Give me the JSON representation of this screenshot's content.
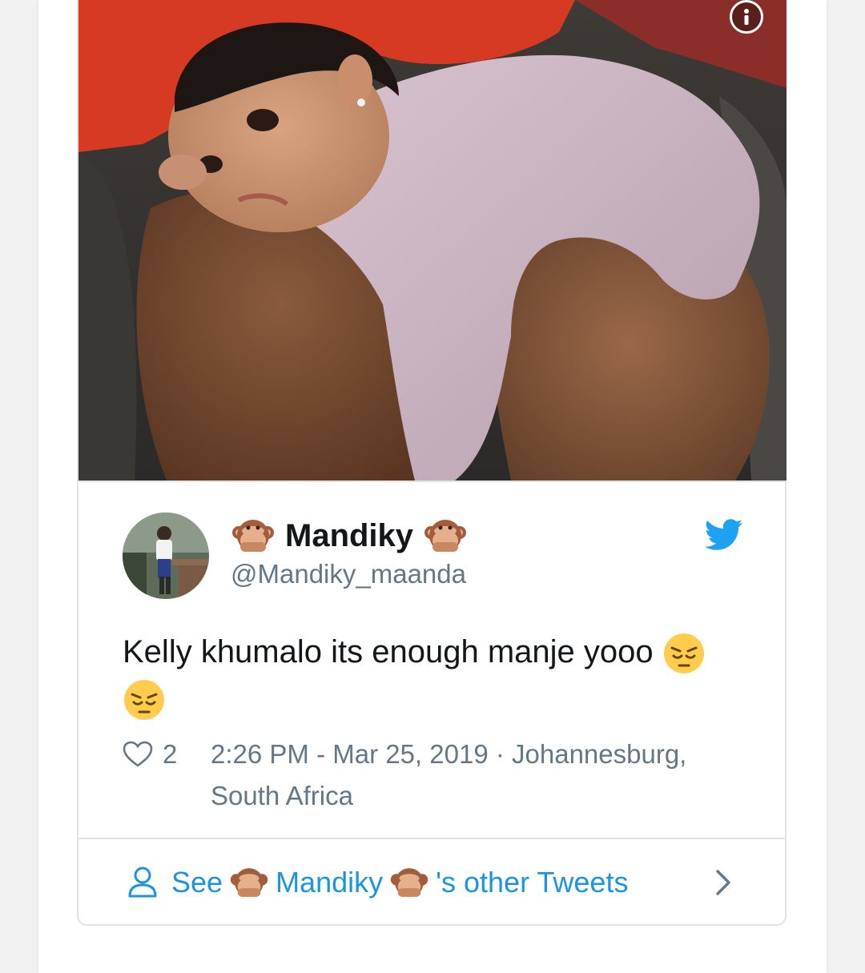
{
  "tweet": {
    "display_name": "Mandiky",
    "handle": "@Mandiky_maanda",
    "text": "Kelly khumalo its enough manje yooo",
    "likes": "2",
    "timestamp": "2:26 PM - Mar 25, 2019 · Johannesburg, South Africa"
  },
  "footer": {
    "see_label": "See",
    "name": "Mandiky",
    "suffix": "'s other Tweets"
  },
  "icons": {
    "info": "info-icon",
    "bird": "twitter-bird-icon",
    "heart": "heart-icon",
    "person": "person-icon",
    "chevron": "chevron-right-icon",
    "monkey": "see-no-evil-monkey-emoji",
    "pensive": "pensive-face-emoji"
  },
  "colors": {
    "accent": "#1b95e0",
    "text": "#14171a",
    "muted": "#657786",
    "border": "#dfe3e6"
  }
}
